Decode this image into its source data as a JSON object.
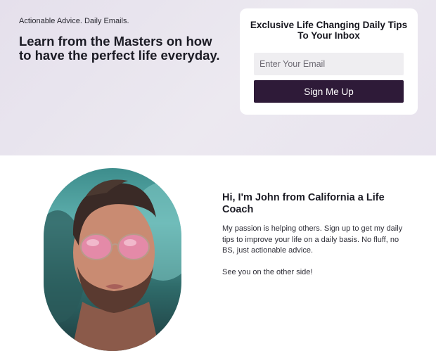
{
  "hero": {
    "tagline": "Actionable Advice. Daily Emails.",
    "headline": "Learn from the Masters on how to have the perfect life everyday."
  },
  "optin": {
    "title": "Exclusive Life Changing Daily Tips To Your Inbox",
    "email_placeholder": "Enter Your Email",
    "button_label": "Sign Me Up"
  },
  "about": {
    "heading": "Hi, I'm John from California a Life Coach",
    "body": "My passion is helping others. Sign up to get my daily tips to improve your life on a daily basis. No fluff, no BS, just actionable advice.",
    "signoff": "See you on the other side!"
  },
  "colors": {
    "hero_background": "#e8e3ee",
    "button_background": "#2e1a38",
    "input_background": "#efeef1",
    "text_dark": "#1b1b24"
  }
}
